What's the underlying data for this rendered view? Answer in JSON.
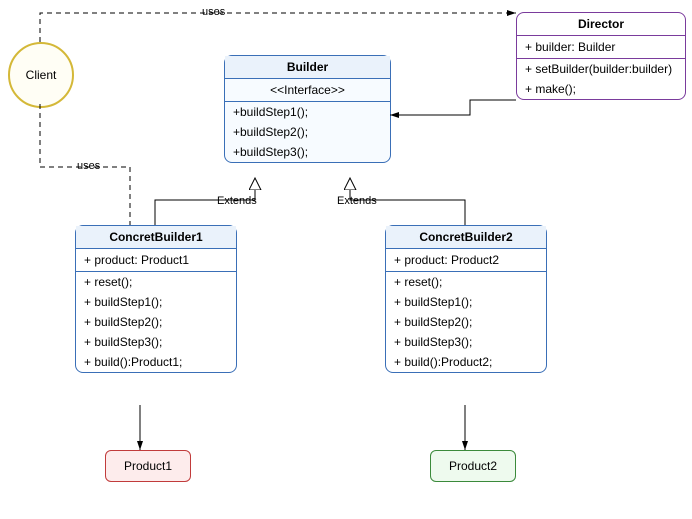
{
  "client": {
    "label": "Client"
  },
  "builder": {
    "title": "Builder",
    "stereotype": "<<Interface>>",
    "methods": [
      "+buildStep1();",
      "+buildStep2();",
      "+buildStep3();"
    ]
  },
  "director": {
    "title": "Director",
    "attrs": [
      "+ builder: Builder"
    ],
    "methods": [
      "+ setBuilder(builder:builder)",
      "+ make();"
    ]
  },
  "cb1": {
    "title": "ConcretBuilder1",
    "attrs": [
      "+ product: Product1"
    ],
    "methods": [
      "+ reset();",
      "+ buildStep1();",
      "+ buildStep2();",
      "+ buildStep3();",
      "+ build():Product1;"
    ]
  },
  "cb2": {
    "title": "ConcretBuilder2",
    "attrs": [
      "+ product: Product2"
    ],
    "methods": [
      "+ reset();",
      "+ buildStep1();",
      "+ buildStep2();",
      "+ buildStep3();",
      "+ build():Product2;"
    ]
  },
  "product1": {
    "label": "Product1"
  },
  "product2": {
    "label": "Product2"
  },
  "edges": {
    "uses1": "uses",
    "uses2": "uses",
    "extends1": "Extends",
    "extends2": "Extends"
  }
}
